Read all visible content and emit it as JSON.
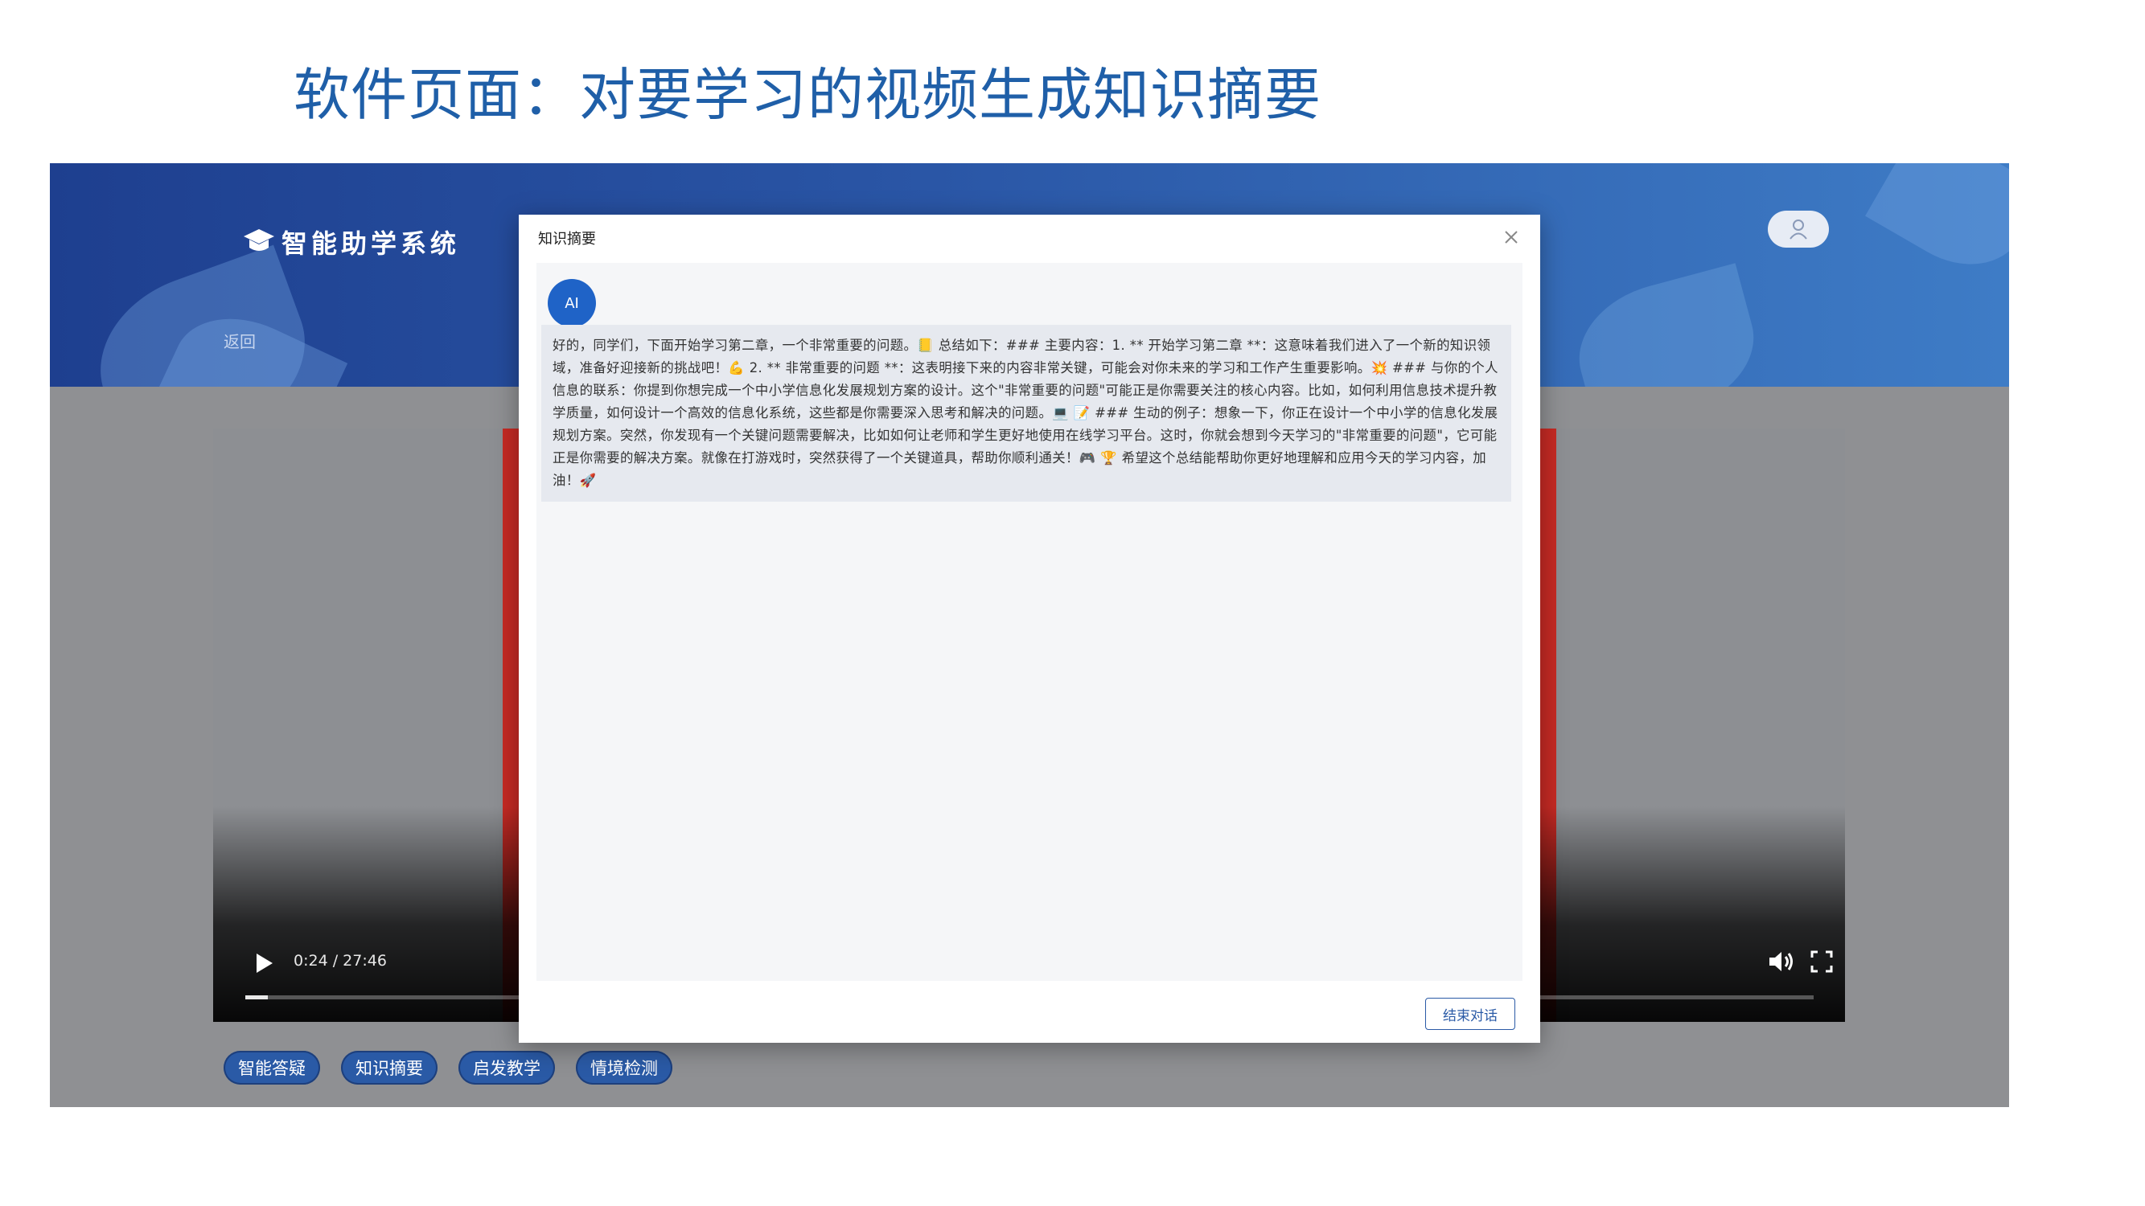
{
  "slide": {
    "title": "软件页面：对要学习的视频生成知识摘要"
  },
  "app": {
    "logo_text": "智能助学系统",
    "back_label": "返回",
    "user_icon": "user-icon"
  },
  "video": {
    "time": "0:24 / 27:46",
    "progress": 0.0145
  },
  "toolbar": {
    "buttons": [
      "智能答疑",
      "知识摘要",
      "启发教学",
      "情境检测"
    ]
  },
  "modal": {
    "title": "知识摘要",
    "avatar_label": "AI",
    "message": "好的，同学们，下面开始学习第二章，一个非常重要的问题。📒 总结如下：### 主要内容：1. ** 开始学习第二章 **：这意味着我们进入了一个新的知识领域，准备好迎接新的挑战吧！💪 2. ** 非常重要的问题 **：这表明接下来的内容非常关键，可能会对你未来的学习和工作产生重要影响。💥 ### 与你的个人信息的联系：你提到你想完成一个中小学信息化发展规划方案的设计。这个\"非常重要的问题\"可能正是你需要关注的核心内容。比如，如何利用信息技术提升教学质量，如何设计一个高效的信息化系统，这些都是你需要深入思考和解决的问题。💻 📝 ### 生动的例子：想象一下，你正在设计一个中小学的信息化发展规划方案。突然，你发现有一个关键问题需要解决，比如如何让老师和学生更好地使用在线学习平台。这时，你就会想到今天学习的\"非常重要的问题\"，它可能正是你需要的解决方案。就像在打游戏时，突然获得了一个关键道具，帮助你顺利通关！🎮 🏆 希望这个总结能帮助你更好地理解和应用今天的学习内容，加油！🚀",
    "end_button": "结束对话"
  }
}
